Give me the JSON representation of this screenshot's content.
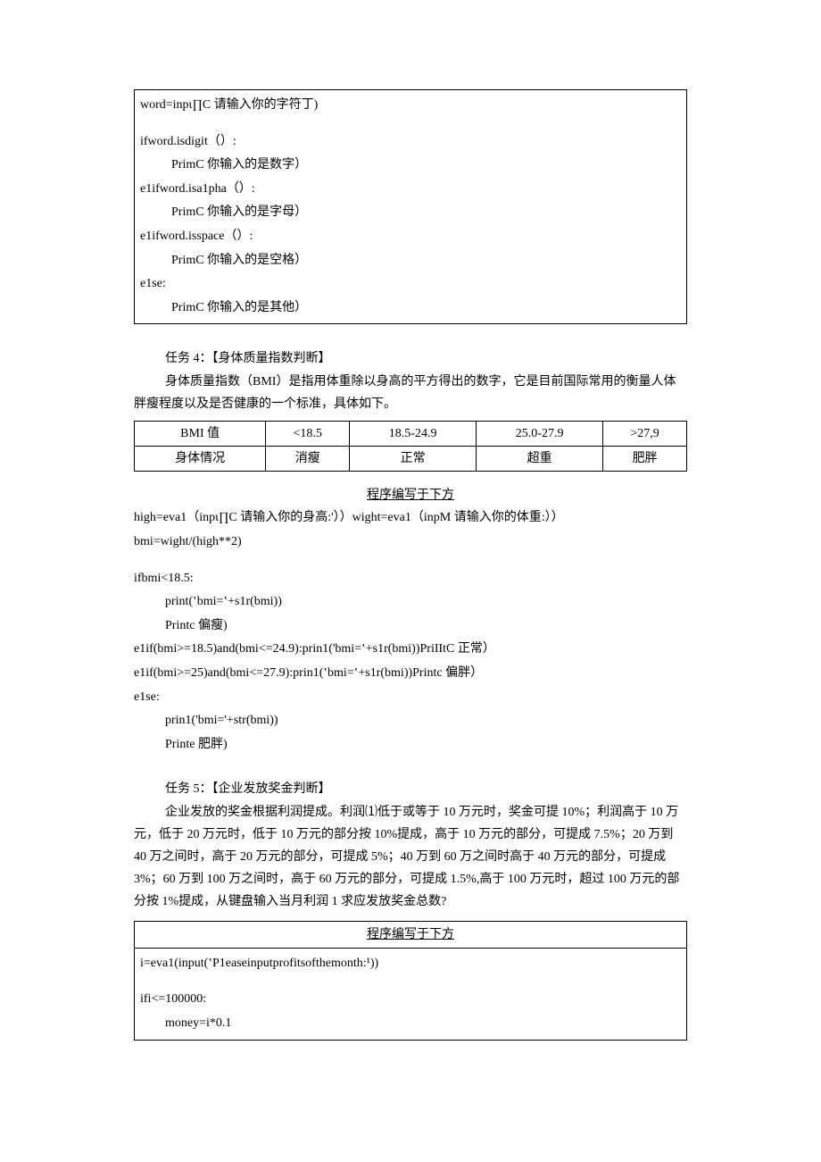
{
  "box1": {
    "l1": "word=inpι∏C 请输入你的字符丁)",
    "l2": "ifword.isdigit（）:",
    "l3": "PrimC 你输入的是数字）",
    "l4": "e1ifword.isa1pha（）:",
    "l5": "PrimC 你输入的是字母）",
    "l6": "e1ifword.isspace（）:",
    "l7": "PrimC 你输入的是空格）",
    "l8": "e1se:",
    "l9": "PrimC 你输入的是其他）"
  },
  "task4": {
    "title": "任务 4：【身体质量指数判断】",
    "desc": "身体质量指数（BMI）是指用体重除以身高的平方得出的数字，它是目前国际常用的衡量人体胖瘦程度以及是否健康的一个标准，具体如下。",
    "table": {
      "r1c1": "BMI 值",
      "r1c2": "<18.5",
      "r1c3": "18.5-24.9",
      "r1c4": "25.0-27.9",
      "r1c5": ">27,9",
      "r2c1": "身体情况",
      "r2c2": "消瘦",
      "r2c3": "正常",
      "r2c4": "超重",
      "r2c5": "肥胖"
    },
    "code_title": "程序编写于下方",
    "c1": "high=eva1（inpι∏C 请输入你的身高:'））wight=eva1（inpM 请输入你的体重:））",
    "c2": "bmi=wight/(high**2)",
    "c3": "ifbmi<18.5:",
    "c4": "print(‛bmi=‛+s1r(bmi))",
    "c5": "Printc 偏瘦)",
    "c6": "e1if(bmi>=18.5)and(bmi<=24.9):prin1('bmi=‛+s1r(bmi))PriIItC 正常）",
    "c7": "e1if(bmi>=25)and(bmi<=27.9):prin1(‛bmi=‛+s1r(bmi))Printc 偏胖）",
    "c8": "e1se:",
    "c9": "prin1('bmi='+str(bmi))",
    "c10": "Printe 肥胖)"
  },
  "task5": {
    "title": "任务 5：【企业发放奖金判断】",
    "desc": "企业发放的奖金根据利润提成。利润⑴低于或等于 10 万元时，奖金可提 10%；利润高于 10 万元，低于 20 万元时，低于 10 万元的部分按 10%提成，高于 10 万元的部分，可提成 7.5%；20 万到 40 万之间时，高于 20 万元的部分，可提成 5%；40 万到 60 万之间时高于 40 万元的部分，可提成 3%；60 万到 100 万之间时，高于 60 万元的部分，可提成 1.5%,高于 100 万元时，超过 100 万元的部分按 1%提成，从键盘输入当月利润 1 求应发放奖金总数?",
    "code_title": "程序编写于下方",
    "c1": "i=eva1(input(‛P1easeinputprofitsofthemonth:¹))",
    "c2": "ifi<=100000:",
    "c3": "money=i*0.1"
  }
}
